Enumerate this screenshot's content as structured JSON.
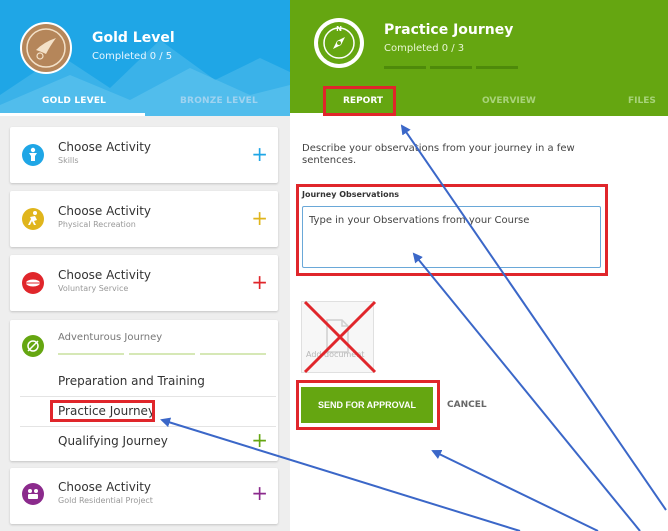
{
  "left_header": {
    "title": "Gold Level",
    "subtitle": "Completed 0 / 5",
    "tabs": [
      "GOLD LEVEL",
      "BRONZE LEVEL"
    ],
    "badge_icon": "gold-bird-badge-icon"
  },
  "activities": [
    {
      "title": "Choose Activity",
      "subtitle": "Skills",
      "icon": "skills-person-icon",
      "color": "#1fa6e6"
    },
    {
      "title": "Choose Activity",
      "subtitle": "Physical Recreation",
      "icon": "physical-runner-icon",
      "color": "#e0b51c"
    },
    {
      "title": "Choose Activity",
      "subtitle": "Voluntary Service",
      "icon": "voluntary-lips-icon",
      "color": "#e0262b"
    }
  ],
  "adventurous": {
    "title": "Adventurous Journey",
    "items": [
      "Preparation and Training",
      "Practice Journey",
      "Qualifying Journey"
    ],
    "color": "#65a611"
  },
  "residential": {
    "title": "Choose Activity",
    "subtitle": "Gold Residential Project",
    "color": "#8b2a8c"
  },
  "right_header": {
    "title": "Practice Journey",
    "subtitle": "Completed 0 / 3",
    "tabs": [
      "REPORT",
      "OVERVIEW",
      "FILES"
    ],
    "badge_icon": "compass-icon"
  },
  "report": {
    "description": "Describe your observations from your journey in a few sentences.",
    "observations_label": "Journey Observations",
    "observations_value": "Type in your Observations from your Course",
    "add_document": "Add document",
    "send_button": "SEND FOR APPROVAL",
    "cancel": "CANCEL"
  },
  "colors": {
    "gold_header": "#1fa6e6",
    "journey_header": "#65a611",
    "highlight": "#e0262b",
    "arrow": "#3b67c8"
  }
}
